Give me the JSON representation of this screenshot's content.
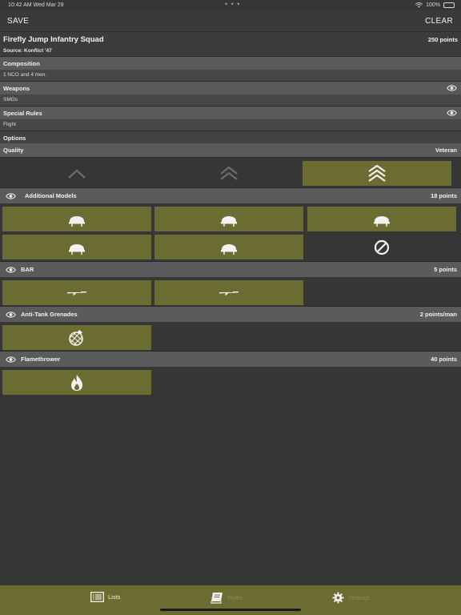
{
  "status_bar": {
    "time": "10:42 AM  Wed Mar 29",
    "dots": "• • •",
    "battery": "100%"
  },
  "nav": {
    "save_label": "SAVE",
    "clear_label": "CLEAR"
  },
  "unit": {
    "title": "Firefly Jump Infantry Squad",
    "points": "250 points",
    "source": "Source: Konflict '47"
  },
  "composition": {
    "label": "Composition",
    "text": "1 NCO and 4 men."
  },
  "weapons": {
    "label": "Weapons",
    "text": "SMGs"
  },
  "special_rules": {
    "label": "Special Rules",
    "text": "Flight"
  },
  "options": {
    "label": "Options"
  },
  "quality": {
    "label": "Quality",
    "value": "Veteran",
    "levels": [
      "inexperienced-icon",
      "regular-icon",
      "veteran-icon"
    ],
    "selected_index": 2
  },
  "groups": {
    "additional_models": {
      "label": "Additional Models",
      "points": "18 points",
      "icon": "helmet-icon",
      "count": 5
    },
    "bar": {
      "label": "BAR",
      "points": "5 points",
      "icon": "rifle-icon",
      "count": 2
    },
    "anti_tank_grenades": {
      "label": "Anti-Tank Grenades",
      "points": "2 points/man",
      "icon": "grenade-icon",
      "count": 1
    },
    "flamethrower": {
      "label": "Flamethrower",
      "points": "40 points",
      "icon": "flame-icon",
      "count": 1
    }
  },
  "tabs": [
    {
      "label": "Lists",
      "icon": "list-icon",
      "active": true
    },
    {
      "label": "Rules",
      "icon": "book-icon",
      "active": false
    },
    {
      "label": "Settings",
      "icon": "gear-icon",
      "active": false
    }
  ],
  "colors": {
    "accent": "#6b6c31",
    "background": "#363636",
    "section_header": "#5a5a5a"
  }
}
